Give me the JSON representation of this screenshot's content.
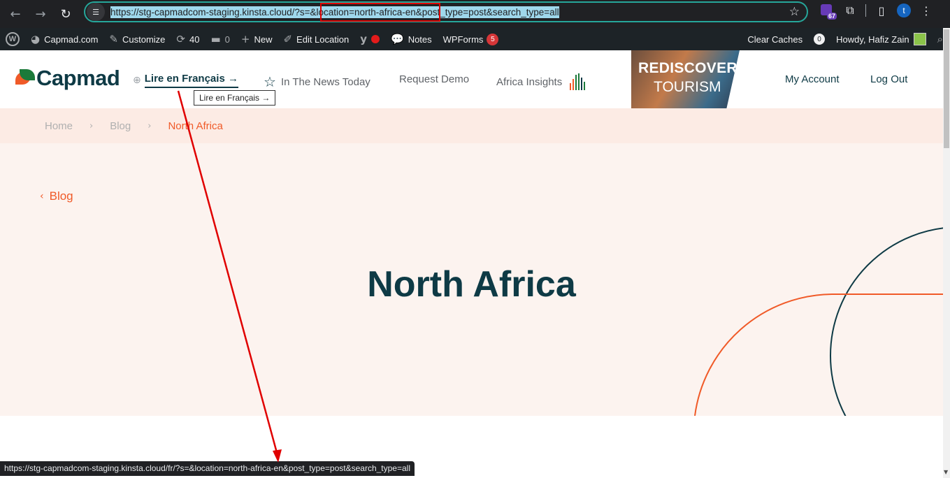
{
  "browser": {
    "url_prefix": "https://stg-capmadcom-staging.kinsta.cloud/?s=",
    "url_middle": "&location=north-africa-en",
    "url_suffix": "&post_type=post&search_type=all",
    "extension_badge": "67",
    "profile_initial": "t",
    "icons": [
      "back-icon",
      "forward-icon",
      "reload-icon",
      "site-info-icon",
      "bookmark-star-icon",
      "extension-icon",
      "puzzle-icon",
      "side-panel-icon",
      "menu-dots-icon"
    ]
  },
  "adminbar": {
    "site_name": "Capmad.com",
    "customize": "Customize",
    "updates_count": "40",
    "comments_count": "0",
    "new_label": "New",
    "edit_location": "Edit Location",
    "notes": "Notes",
    "wpforms": "WPForms",
    "wpforms_count": "5",
    "clear_caches": "Clear Caches",
    "notif_count": "0",
    "howdy": "Howdy, Hafiz Zain"
  },
  "header": {
    "logo_text": "Capmad",
    "lang_link": "Lire en Français →",
    "tooltip": "Lire en Français →",
    "nav": {
      "news_today": "In The News Today",
      "request_demo": "Request Demo",
      "africa_insights": "Africa Insights"
    },
    "promo_top": "REDISCOVER",
    "promo_bottom": "TOURISM",
    "my_account": "My Account",
    "log_out": "Log Out"
  },
  "breadcrumb": {
    "home": "Home",
    "blog": "Blog",
    "current": "North Africa"
  },
  "hero": {
    "back_label": "Blog",
    "title": "North Africa"
  },
  "status_bar": {
    "url": "https://stg-capmadcom-staging.kinsta.cloud/fr/?s=&location=north-africa-en&post_type=post&search_type=all"
  },
  "colors": {
    "brand_dark": "#0e3a45",
    "brand_orange": "#f05a28",
    "annotation_red": "#e00000"
  }
}
